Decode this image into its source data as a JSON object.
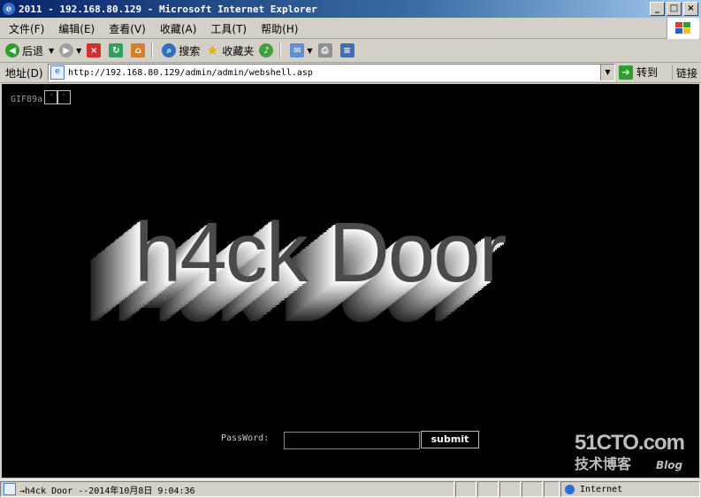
{
  "window": {
    "title": "2011 - 192.168.80.129 - Microsoft Internet Explorer",
    "min": "_",
    "max": "□",
    "close": "×"
  },
  "menu": [
    "文件(F)",
    "编辑(E)",
    "查看(V)",
    "收藏(A)",
    "工具(T)",
    "帮助(H)"
  ],
  "toolbar": {
    "back": "后退",
    "search": "搜索",
    "favorites": "收藏夹"
  },
  "address": {
    "label": "地址(D)",
    "url": "http://192.168.80.129/admin/admin/webshell.asp",
    "go": "转到",
    "links": "链接"
  },
  "page": {
    "gif_text": "GIF89a",
    "box1": "·",
    "box2": "·",
    "headline": "h4ck Door",
    "password_label": "PassWord:",
    "password_value": "",
    "submit_label": "submit"
  },
  "watermark": {
    "line1": "51CTO.com",
    "line2": "技术博客",
    "line3": "Blog"
  },
  "status": {
    "text": "→h4ck Door --2014年10月8日 9:04:36",
    "zone": "Internet"
  }
}
